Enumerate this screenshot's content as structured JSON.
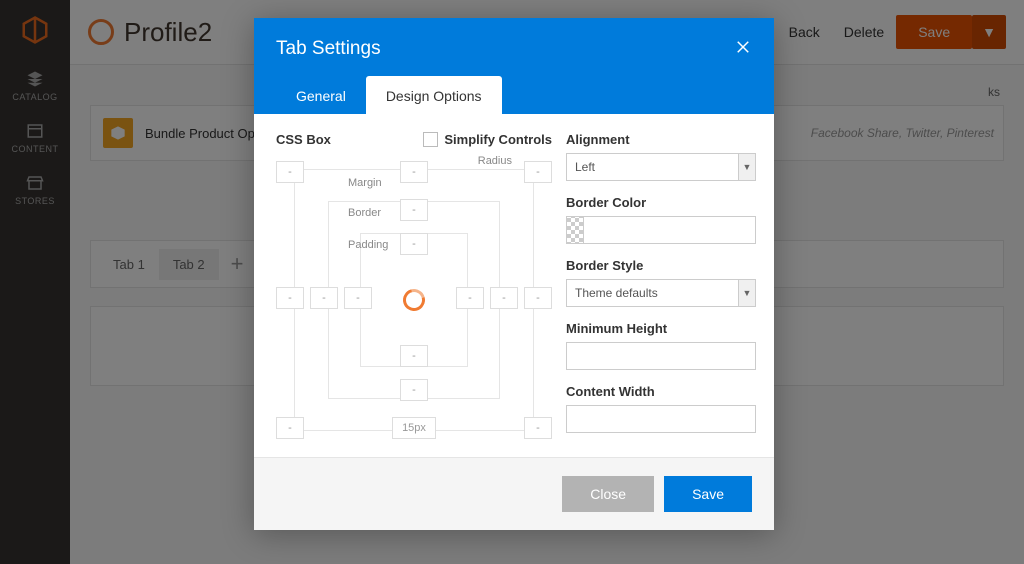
{
  "sidebar": {
    "items": [
      {
        "label": "CATALOG"
      },
      {
        "label": "CONTENT"
      },
      {
        "label": "STORES"
      }
    ]
  },
  "header": {
    "title": "Profile2",
    "back": "Back",
    "delete": "Delete",
    "save": "Save"
  },
  "page": {
    "bundle_label": "Bundle Product Option",
    "share_text": "Facebook Share, Twitter, Pinterest",
    "tabs": [
      "Tab 1",
      "Tab 2"
    ]
  },
  "modal": {
    "title": "Tab Settings",
    "tabs": {
      "general": "General",
      "design": "Design Options"
    },
    "cssbox": {
      "title": "CSS Box",
      "simplify": "Simplify Controls",
      "margin": "Margin",
      "border": "Border",
      "padding": "Padding",
      "radius": "Radius",
      "dash": "-",
      "bottom_value": "15px"
    },
    "fields": {
      "alignment": {
        "label": "Alignment",
        "value": "Left"
      },
      "border_color": {
        "label": "Border Color"
      },
      "border_style": {
        "label": "Border Style",
        "value": "Theme defaults"
      },
      "min_height": {
        "label": "Minimum Height"
      },
      "content_width": {
        "label": "Content Width"
      }
    },
    "buttons": {
      "close": "Close",
      "save": "Save"
    }
  }
}
